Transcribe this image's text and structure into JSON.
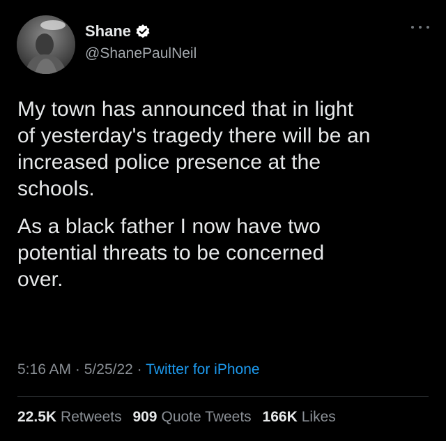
{
  "user": {
    "display_name": "Shane",
    "handle": "@ShanePaulNeil",
    "verified": true,
    "avatar": "person-photo"
  },
  "tweet": {
    "paragraphs": [
      {
        "lines": [
          "My town has announced that in light",
          "of yesterday's tragedy there will be an",
          "increased police presence at the",
          "schools."
        ]
      },
      {
        "lines": [
          "As a black father I now have two",
          "potential threats to be concerned",
          "over."
        ]
      }
    ]
  },
  "meta": {
    "time": "5:16 AM",
    "date": "5/25/22",
    "separator": "·",
    "source": "Twitter for iPhone"
  },
  "stats": {
    "retweets": {
      "count": "22.5K",
      "label": "Retweets"
    },
    "quotes": {
      "count": "909",
      "label": "Quote Tweets"
    },
    "likes": {
      "count": "166K",
      "label": "Likes"
    }
  },
  "colors": {
    "background": "#000000",
    "text": "#e7e9ea",
    "secondary": "#8b9096",
    "link": "#1d9bf0",
    "verified": "#ffffff"
  }
}
